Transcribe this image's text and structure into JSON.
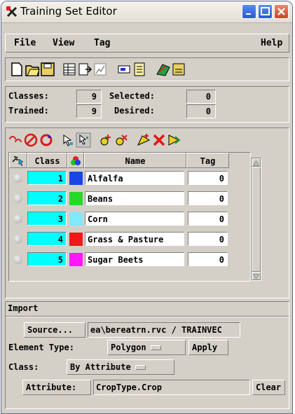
{
  "window": {
    "title": "Training Set Editor"
  },
  "menu": {
    "file": "File",
    "view": "View",
    "tag": "Tag",
    "help": "Help"
  },
  "toolbar_icons": [
    "new-icon",
    "open-icon",
    "save-icon",
    "table-icon",
    "export-icon",
    "chart-icon",
    "list-icon",
    "document-icon",
    "map-icon",
    "saveas-icon"
  ],
  "stats": {
    "classes_label": "Classes:",
    "classes_value": "9",
    "selected_label": "Selected:",
    "selected_value": "0",
    "trained_label": "Trained:",
    "trained_value": "9",
    "desired_label": "Desired:",
    "desired_value": "0"
  },
  "class_tools": [
    "link-icon",
    "no-icon",
    "refresh-icon",
    "select-point-icon",
    "select-multi-icon",
    "add-class-icon",
    "remove-class-icon",
    "add-all-icon",
    "delete-icon",
    "merge-icon"
  ],
  "table": {
    "columns": {
      "sort": "",
      "class": "Class",
      "color": "",
      "name": "Name",
      "tag": "Tag"
    },
    "rows": [
      {
        "class": "1",
        "color": "#1844e8",
        "name": "Alfalfa",
        "tag": "0"
      },
      {
        "class": "2",
        "color": "#28d828",
        "name": "Beans",
        "tag": "0"
      },
      {
        "class": "3",
        "color": "#80e8ff",
        "name": "Corn",
        "tag": "0"
      },
      {
        "class": "4",
        "color": "#f01818",
        "name": "Grass & Pasture",
        "tag": "0"
      },
      {
        "class": "5",
        "color": "#ff18ff",
        "name": "Sugar Beets",
        "tag": "0"
      }
    ]
  },
  "import": {
    "heading": "Import",
    "source_button": "Source...",
    "source_value": "ea\\bereatrn.rvc / TRAINVEC",
    "element_type_label": "Element Type:",
    "element_type_value": "Polygon",
    "apply_button": "Apply",
    "class_label": "Class:",
    "class_value": "By Attribute",
    "attribute_button": "Attribute:",
    "attribute_value": "CropType.Crop",
    "clear_button": "Clear"
  }
}
